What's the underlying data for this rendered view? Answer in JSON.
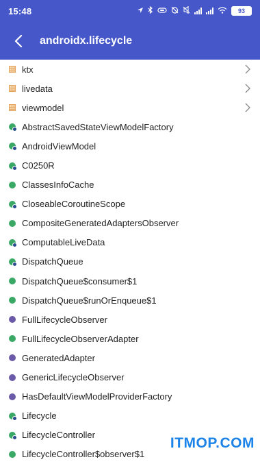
{
  "status": {
    "time": "15:48",
    "battery": "93"
  },
  "toolbar": {
    "title": "androidx.lifecycle"
  },
  "items": [
    {
      "label": "ktx",
      "kind": "package",
      "chevron": true
    },
    {
      "label": "livedata",
      "kind": "package",
      "chevron": true
    },
    {
      "label": "viewmodel",
      "kind": "package",
      "chevron": true
    },
    {
      "label": "AbstractSavedStateViewModelFactory",
      "kind": "abstract-class"
    },
    {
      "label": "AndroidViewModel",
      "kind": "abstract-class"
    },
    {
      "label": "C0250R",
      "kind": "abstract-class"
    },
    {
      "label": "ClassesInfoCache",
      "kind": "class"
    },
    {
      "label": "CloseableCoroutineScope",
      "kind": "abstract-class"
    },
    {
      "label": "CompositeGeneratedAdaptersObserver",
      "kind": "class"
    },
    {
      "label": "ComputableLiveData",
      "kind": "abstract-class"
    },
    {
      "label": "DispatchQueue",
      "kind": "abstract-class"
    },
    {
      "label": "DispatchQueue$consumer$1",
      "kind": "class"
    },
    {
      "label": "DispatchQueue$runOrEnqueue$1",
      "kind": "class"
    },
    {
      "label": "FullLifecycleObserver",
      "kind": "interface"
    },
    {
      "label": "FullLifecycleObserverAdapter",
      "kind": "class"
    },
    {
      "label": "GeneratedAdapter",
      "kind": "interface"
    },
    {
      "label": "GenericLifecycleObserver",
      "kind": "interface"
    },
    {
      "label": "HasDefaultViewModelProviderFactory",
      "kind": "interface"
    },
    {
      "label": "Lifecycle",
      "kind": "abstract-class"
    },
    {
      "label": "LifecycleController",
      "kind": "abstract-class"
    },
    {
      "label": "LifecycleController$observer$1",
      "kind": "class"
    }
  ],
  "watermark": "ITMOP.COM",
  "colors": {
    "header": "#4557c9",
    "package": "#e7a65f",
    "class": "#3aa966",
    "interface": "#6a5aa8",
    "watermark": "#1c84e8"
  }
}
